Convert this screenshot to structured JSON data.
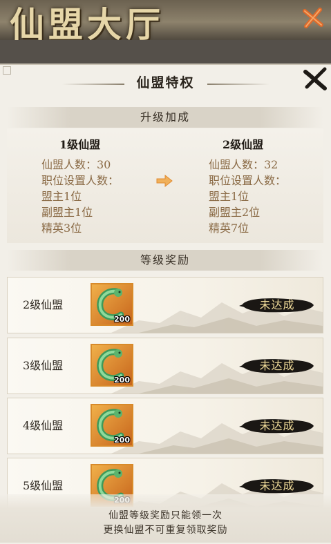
{
  "top_banner": {
    "title": "仙盟大厅"
  },
  "panel": {
    "title": "仙盟特权"
  },
  "upgrade": {
    "section_label": "升级加成",
    "current": {
      "heading": "1级仙盟",
      "member_count": "仙盟人数：30",
      "positions_label": "职位设置人数：",
      "leader": "盟主1位",
      "vice_leader": "副盟主1位",
      "elite": "精英3位"
    },
    "next": {
      "heading": "2级仙盟",
      "member_count": "仙盟人数：32",
      "positions_label": "职位设置人数：",
      "leader": "盟主1位",
      "vice_leader": "副盟主2位",
      "elite": "精英7位"
    }
  },
  "rewards": {
    "section_label": "等级奖励",
    "rows": [
      {
        "name": "2级仙盟",
        "quantity": "200",
        "status": "未达成",
        "icon": "jade-pendant-icon"
      },
      {
        "name": "3级仙盟",
        "quantity": "200",
        "status": "未达成",
        "icon": "jade-pendant-icon"
      },
      {
        "name": "4级仙盟",
        "quantity": "200",
        "status": "未达成",
        "icon": "jade-pendant-icon"
      },
      {
        "name": "5级仙盟",
        "quantity": "200",
        "status": "未达成",
        "icon": "jade-pendant-icon"
      }
    ]
  },
  "footer": {
    "line1": "仙盟等级奖励只能领一次",
    "line2": "更换仙盟不可重复领取奖励"
  },
  "colors": {
    "attr_text": "#8a6a45",
    "status_text": "#f1dc9a",
    "item_border": "#d88a2a",
    "close_accent": "#e06a2a"
  }
}
